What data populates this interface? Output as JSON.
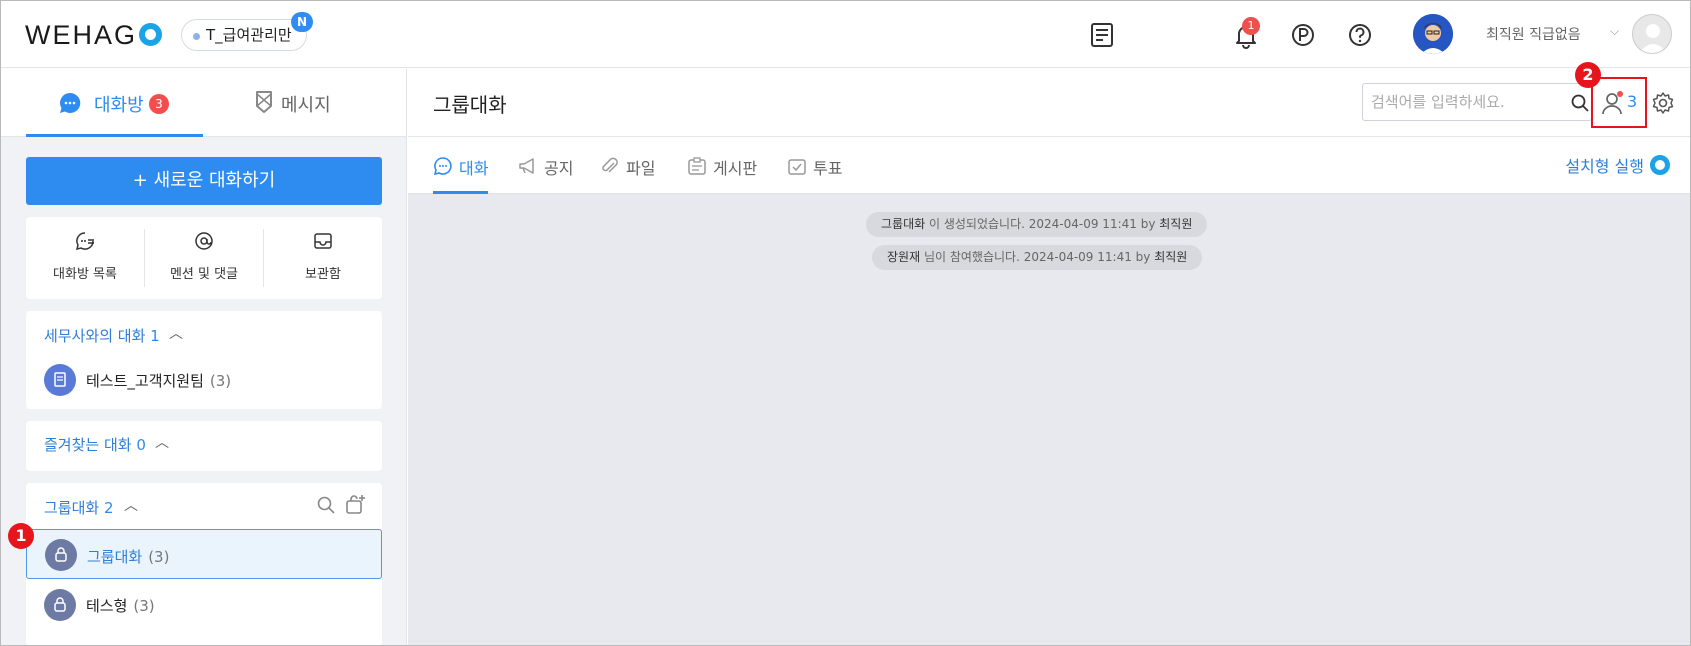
{
  "header": {
    "logo_text": "WEHAG",
    "company_name": "T_급여관리만",
    "company_badge": "N",
    "notification_count": "1",
    "user_name": "최직원 직급없음"
  },
  "left": {
    "tabs": [
      {
        "label": "대화방",
        "badge": "3"
      },
      {
        "label": "메시지"
      }
    ],
    "new_chat_label": "+ 새로운 대화하기",
    "quick_actions": [
      {
        "label": "대화방 목록"
      },
      {
        "label": "멘션 및 댓글"
      },
      {
        "label": "보관함"
      }
    ],
    "sections": [
      {
        "title": "세무사와의 대화",
        "count": "1",
        "items": [
          {
            "name": "테스트_고객지원팀",
            "count": "(3)"
          }
        ]
      },
      {
        "title": "즐겨찾는 대화",
        "count": "0",
        "items": []
      },
      {
        "title": "그룹대화",
        "count": "2",
        "items": [
          {
            "name": "그룹대화",
            "count": "(3)"
          },
          {
            "name": "테스형",
            "count": "(3)"
          }
        ]
      }
    ]
  },
  "main": {
    "title": "그룹대화",
    "search_placeholder": "검색어를 입력하세요.",
    "member_count": "3",
    "tabs": [
      {
        "label": "대화"
      },
      {
        "label": "공지"
      },
      {
        "label": "파일"
      },
      {
        "label": "게시판"
      },
      {
        "label": "투표"
      }
    ],
    "install_label": "설치형 실행",
    "messages": [
      {
        "subject": "그룹대화",
        "text": " 이 생성되었습니다.  2024-04-09 11:41  by ",
        "actor": "최직원"
      },
      {
        "subject": "장원재",
        "text": " 님이 참여했습니다.  2024-04-09 11:41  by ",
        "actor": "최직원"
      }
    ]
  },
  "annotations": [
    "1",
    "2"
  ],
  "colors": {
    "accent": "#2e8cf0",
    "badge": "#f24e4e",
    "callout": "#e8141d"
  }
}
